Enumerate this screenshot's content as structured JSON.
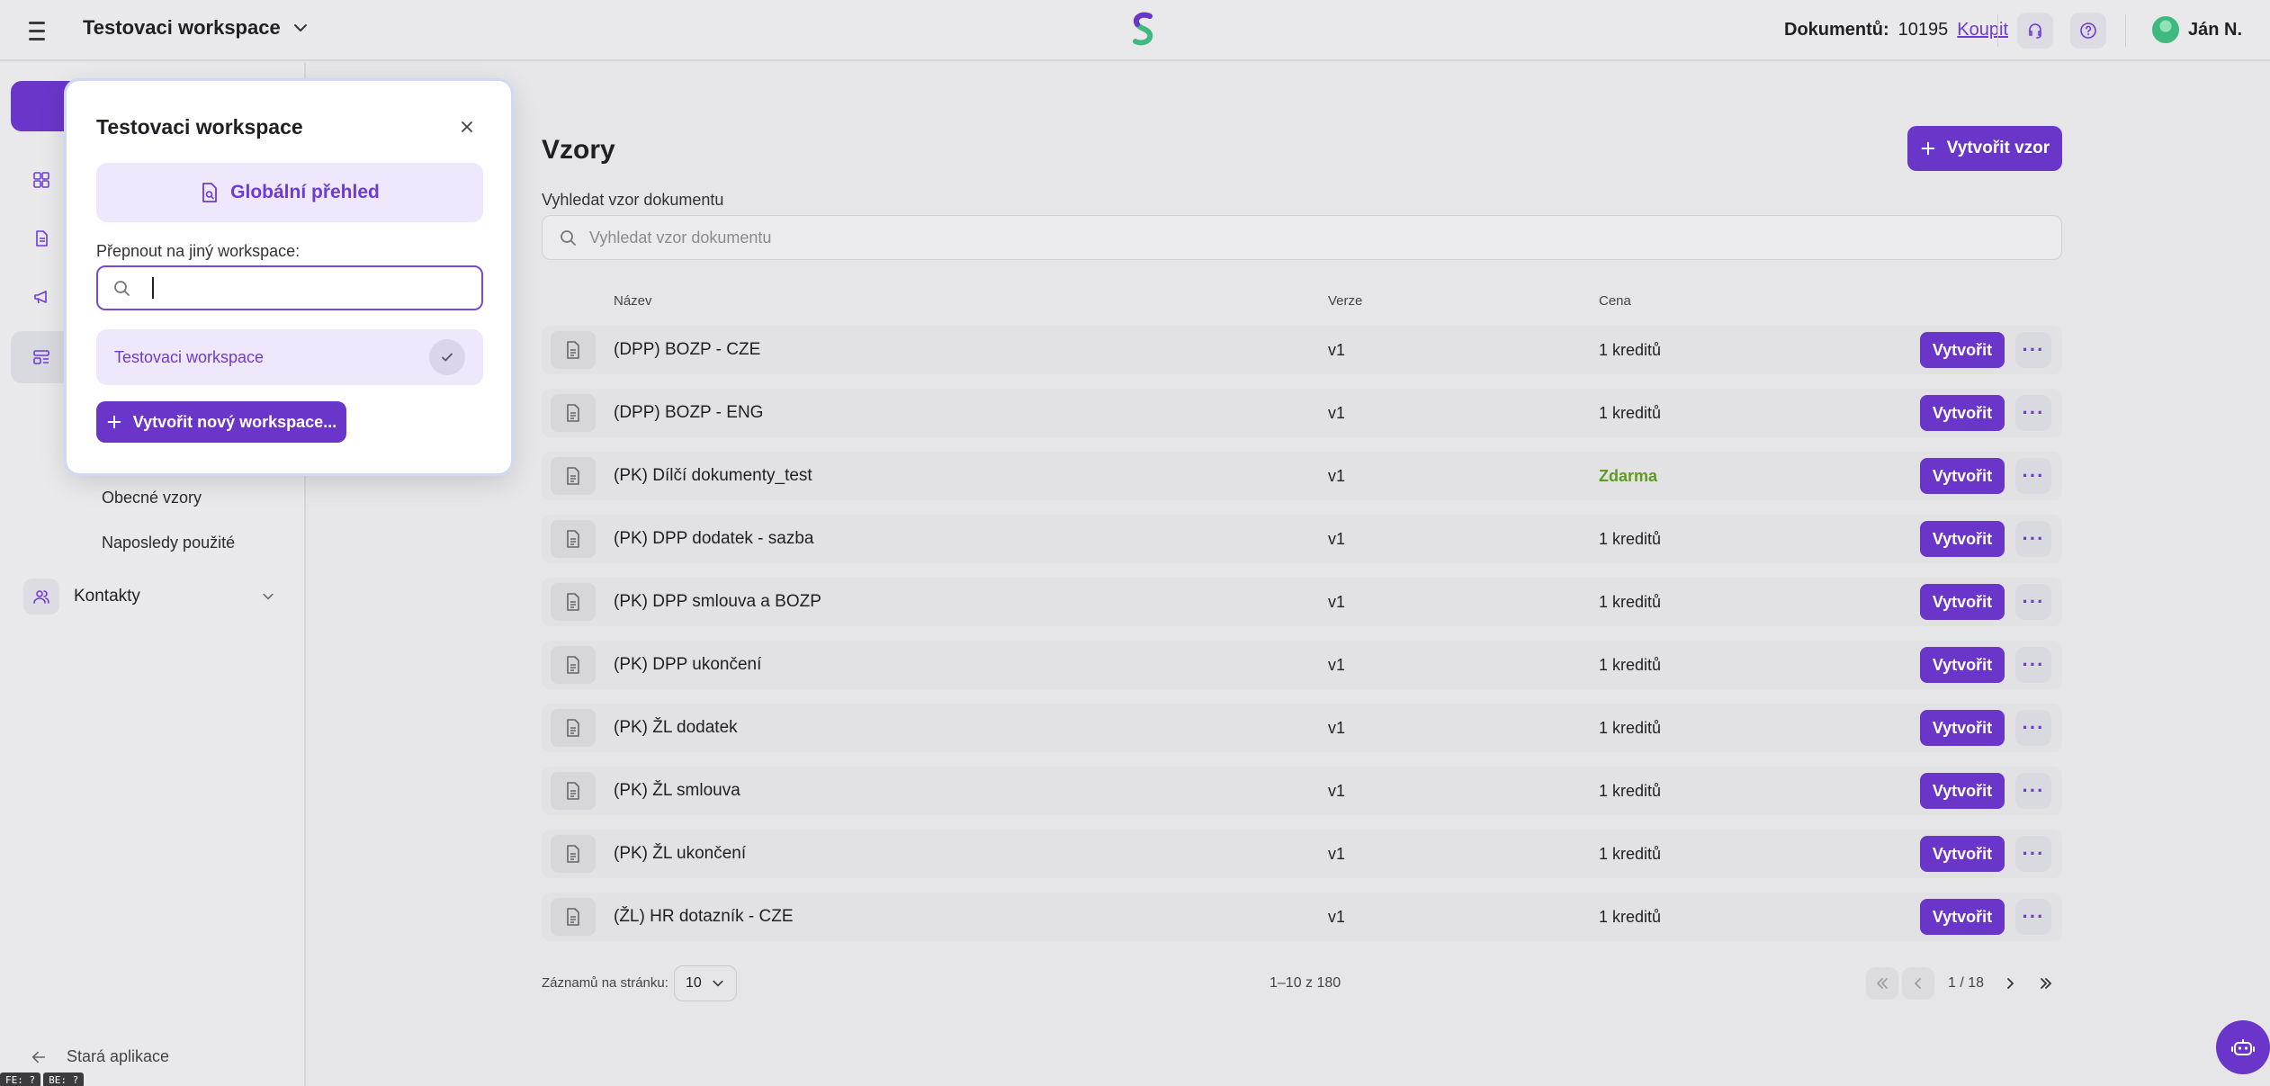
{
  "header": {
    "workspace_name": "Testovaci workspace",
    "documents_label": "Dokumentů:",
    "documents_count": "10195",
    "buy_label": "Koupit",
    "user_name": "Ján N."
  },
  "sidebar": {
    "subitems": [
      "Obecné vzory",
      "Naposledy použité"
    ],
    "contacts_label": "Kontakty",
    "old_app_label": "Stará aplikace",
    "badges": [
      "FE: ?",
      "BE: ?"
    ]
  },
  "main": {
    "title": "Vzory",
    "create_button": "Vytvořit vzor",
    "search_label": "Vyhledat vzor dokumentu",
    "search_placeholder": "Vyhledat vzor dokumentu",
    "columns": {
      "name": "Název",
      "version": "Verze",
      "price": "Cena"
    },
    "row_action_label": "Vytvořit",
    "rows": [
      {
        "name": "(DPP) BOZP - CZE",
        "version": "v1",
        "price": "1 kreditů"
      },
      {
        "name": "(DPP) BOZP - ENG",
        "version": "v1",
        "price": "1 kreditů"
      },
      {
        "name": "(PK) Dílčí dokumenty_test",
        "version": "v1",
        "price": "Zdarma"
      },
      {
        "name": "(PK) DPP dodatek - sazba",
        "version": "v1",
        "price": "1 kreditů"
      },
      {
        "name": "(PK) DPP smlouva a BOZP",
        "version": "v1",
        "price": "1 kreditů"
      },
      {
        "name": "(PK) DPP ukončení",
        "version": "v1",
        "price": "1 kreditů"
      },
      {
        "name": "(PK) ŽL dodatek",
        "version": "v1",
        "price": "1 kreditů"
      },
      {
        "name": "(PK) ŽL smlouva",
        "version": "v1",
        "price": "1 kreditů"
      },
      {
        "name": "(PK) ŽL ukončení",
        "version": "v1",
        "price": "1 kreditů"
      },
      {
        "name": "(ŽL) HR dotazník - CZE",
        "version": "v1",
        "price": "1 kreditů"
      }
    ],
    "pagination": {
      "per_page_label": "Záznamů na stránku:",
      "per_page_value": "10",
      "range": "1–10 z 180",
      "page_info": "1 / 18"
    }
  },
  "popover": {
    "title": "Testovaci workspace",
    "global_overview": "Globální přehled",
    "switch_label": "Přepnout na jiný workspace:",
    "search_value": "",
    "workspaces": [
      "Testovaci workspace"
    ],
    "create_new": "Vytvořit nový workspace..."
  },
  "colors": {
    "accent": "#6a36c9",
    "accent_light": "#efe7fb",
    "free": "#5d9c1f"
  }
}
